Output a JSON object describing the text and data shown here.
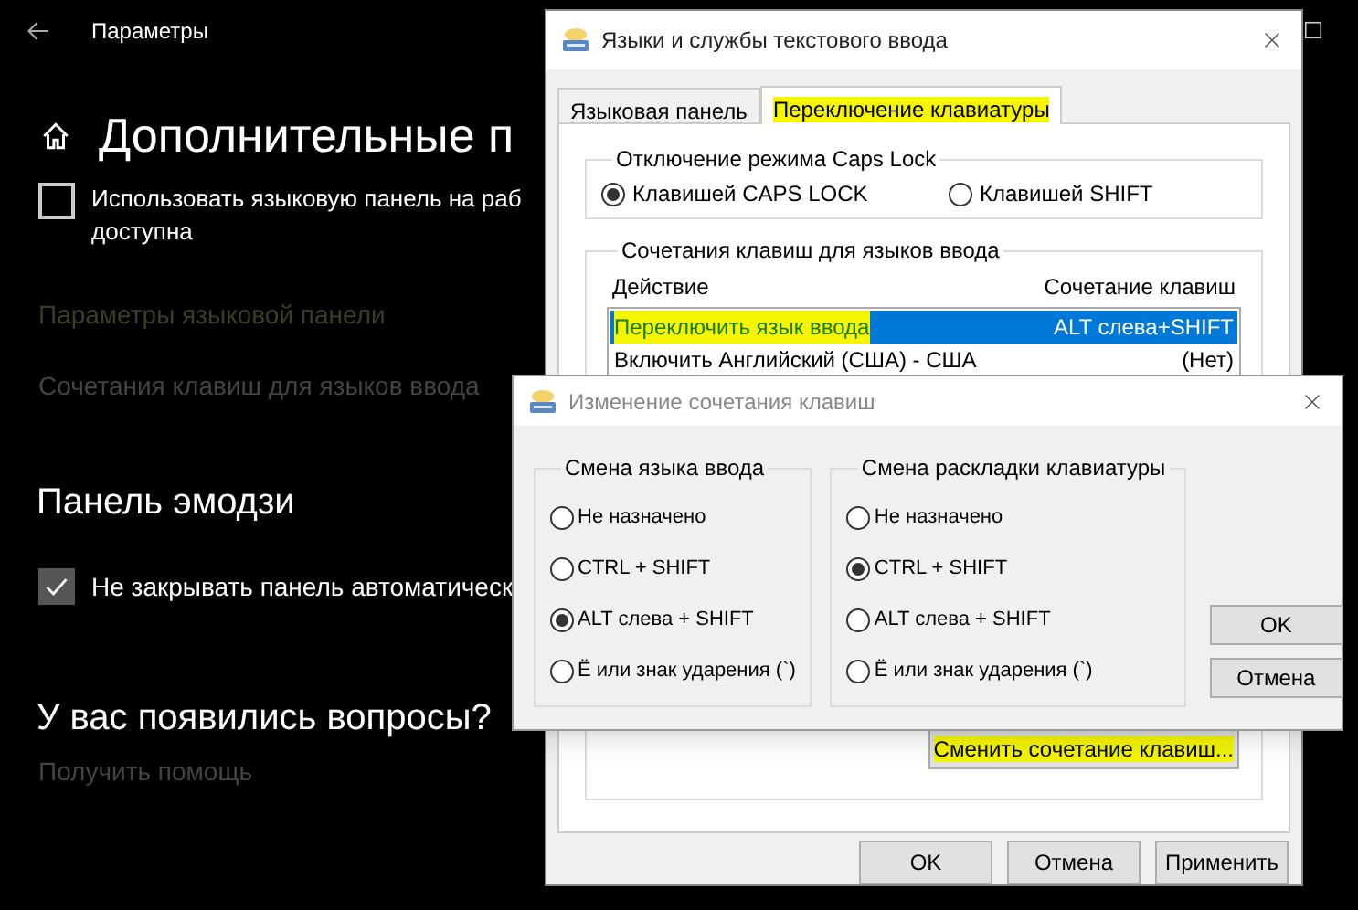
{
  "settings": {
    "window_title": "Параметры",
    "page_title": "Дополнительные п",
    "checks": [
      {
        "lines": [
          "Использовать языковую панель на раб",
          "доступна"
        ],
        "checked": false
      }
    ],
    "links": [
      {
        "label": "Параметры языковой панели",
        "kind": "dim"
      },
      {
        "label": "Сочетания клавиш для языков ввода",
        "kind": "gray"
      }
    ],
    "emoji_heading": "Панель эмодзи",
    "emoji_checks": [
      {
        "label": "Не закрывать панель автоматическ",
        "checked": true
      }
    ],
    "help_heading": "У вас появились вопросы?",
    "help_link": "Получить помощь"
  },
  "languages_dialog": {
    "title": "Языки и службы текстового ввода",
    "tabs": [
      {
        "label": "Языковая панель",
        "selected": false,
        "highlighted": false
      },
      {
        "label": "Переключение клавиатуры",
        "selected": true,
        "highlighted": true
      }
    ],
    "caps_group": {
      "title": "Отключение режима Caps Lock",
      "options": [
        {
          "label": "Клавишей CAPS LOCK",
          "selected": true
        },
        {
          "label": "Клавишей SHIFT",
          "selected": false
        }
      ]
    },
    "hotkeys_group": {
      "title": "Сочетания клавиш для языков ввода",
      "columns": [
        "Действие",
        "Сочетание клавиш"
      ],
      "rows": [
        {
          "action": "Переключить язык ввода",
          "keys": "ALT слева+SHIFT",
          "selected": true,
          "highlighted": true
        },
        {
          "action": "Включить Английский (США) - США",
          "keys": "(Нет)",
          "selected": false,
          "highlighted": false
        }
      ],
      "change_button": {
        "label": "Сменить сочетание клавиш...",
        "highlighted": true
      }
    },
    "buttons": [
      "OK",
      "Отмена",
      "Применить"
    ]
  },
  "change_dialog": {
    "title": "Изменение сочетания клавиш",
    "groups": [
      {
        "title": "Смена языка ввода",
        "options": [
          {
            "label": "Не назначено",
            "selected": false
          },
          {
            "label": "CTRL + SHIFT",
            "selected": false
          },
          {
            "label": "ALT слева + SHIFT",
            "selected": true
          },
          {
            "label": "Ё или знак ударения (`)",
            "selected": false
          }
        ]
      },
      {
        "title": "Смена раскладки клавиатуры",
        "options": [
          {
            "label": "Не назначено",
            "selected": false
          },
          {
            "label": "CTRL + SHIFT",
            "selected": true
          },
          {
            "label": "ALT слева + SHIFT",
            "selected": false
          },
          {
            "label": "Ё или знак ударения (`)",
            "selected": false
          }
        ]
      }
    ],
    "buttons": [
      "OK",
      "Отмена"
    ]
  }
}
